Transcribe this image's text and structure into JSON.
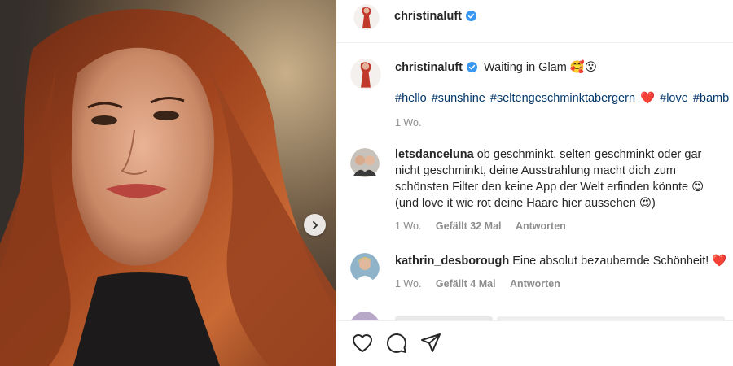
{
  "post": {
    "author": "christinaluft",
    "verified": true
  },
  "caption": {
    "author": "christinaluft",
    "text": "Waiting in Glam",
    "emojis": "🥰😮",
    "hashtags": [
      "#hello",
      "#sunshine",
      "#seltengeschminktabergern",
      "❤️",
      "#love",
      "#bamb"
    ],
    "time": "1 Wo."
  },
  "comments": [
    {
      "author": "letsdanceluna",
      "text": "ob geschminkt, selten geschminkt oder gar nicht geschminkt, deine Ausstrahlung macht dich zum schönsten Filter den keine App der Welt erfinden könnte 😍 (und love it wie rot deine Haare hier aussehen 😍)",
      "time": "1 Wo.",
      "likes": "Gefällt 32 Mal",
      "reply": "Antworten"
    },
    {
      "author": "kathrin_desborough",
      "text": "Eine absolut bezaubernde Schönheit! ❤️",
      "time": "1 Wo.",
      "likes": "Gefällt 4 Mal",
      "reply": "Antworten"
    }
  ],
  "actions": {
    "like_icon": "heart-icon",
    "comment_icon": "comment-icon",
    "share_icon": "share-icon"
  },
  "colors": {
    "link": "#00376b",
    "verified": "#3897f0",
    "muted": "#8e8e8e"
  }
}
